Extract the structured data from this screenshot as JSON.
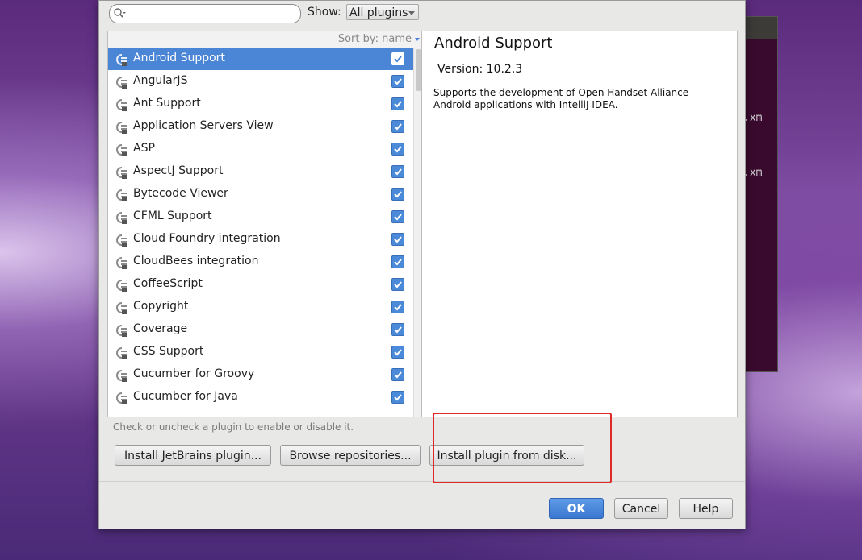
{
  "terminal": {
    "lines": [
      ".xm",
      ".xm"
    ]
  },
  "toolbar": {
    "search_value": "",
    "show_label": "Show:",
    "show_value": "All plugins"
  },
  "list": {
    "sort_label": "Sort by: name",
    "items": [
      {
        "name": "Android Support",
        "checked": true,
        "selected": true
      },
      {
        "name": "AngularJS",
        "checked": true
      },
      {
        "name": "Ant Support",
        "checked": true
      },
      {
        "name": "Application Servers View",
        "checked": true
      },
      {
        "name": "ASP",
        "checked": true
      },
      {
        "name": "AspectJ Support",
        "checked": true
      },
      {
        "name": "Bytecode Viewer",
        "checked": true
      },
      {
        "name": "CFML Support",
        "checked": true
      },
      {
        "name": "Cloud Foundry integration",
        "checked": true
      },
      {
        "name": "CloudBees integration",
        "checked": true
      },
      {
        "name": "CoffeeScript",
        "checked": true
      },
      {
        "name": "Copyright",
        "checked": true
      },
      {
        "name": "Coverage",
        "checked": true
      },
      {
        "name": "CSS Support",
        "checked": true
      },
      {
        "name": "Cucumber for Groovy",
        "checked": true
      },
      {
        "name": "Cucumber for Java",
        "checked": true
      }
    ]
  },
  "detail": {
    "title": "Android Support",
    "version": "Version: 10.2.3",
    "description": "Supports the development of Open Handset Alliance Android applications with IntelliJ IDEA."
  },
  "hint": "Check or uncheck a plugin to enable or disable it.",
  "buttons": {
    "install_jetbrains": "Install JetBrains plugin...",
    "browse_repos": "Browse repositories...",
    "install_disk": "Install plugin from disk...",
    "ok": "OK",
    "cancel": "Cancel",
    "help": "Help"
  },
  "colors": {
    "selection": "#4b85d6",
    "highlight": "#e02a2a",
    "ok_button": "#3a77d0"
  }
}
